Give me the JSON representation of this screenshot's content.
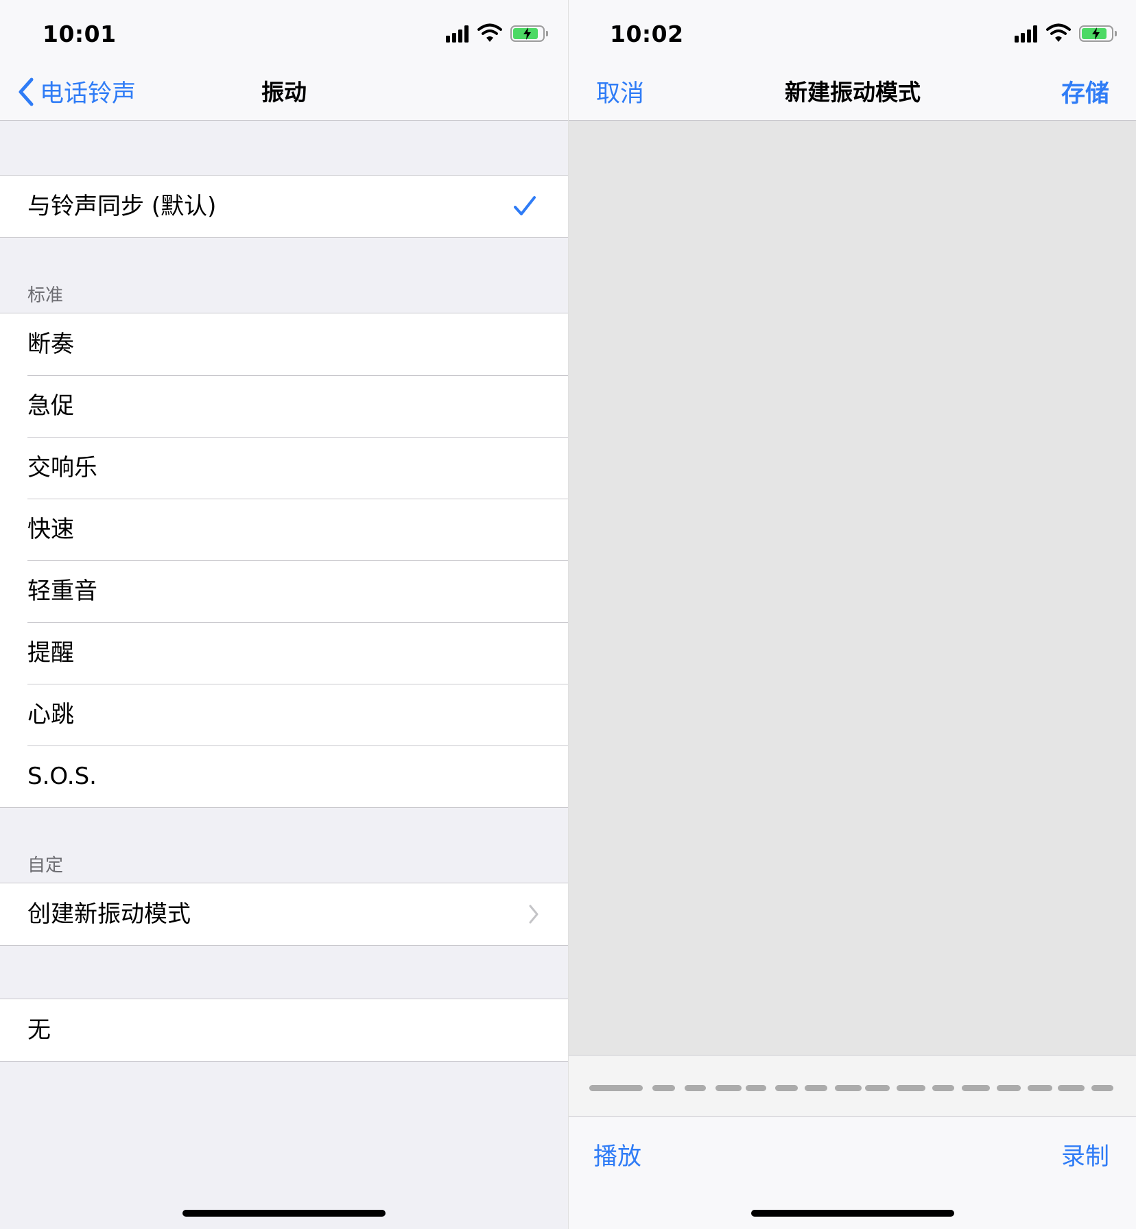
{
  "left": {
    "status": {
      "time": "10:01"
    },
    "nav": {
      "back_label": "电话铃声",
      "title": "振动"
    },
    "sync_row": {
      "label": "与铃声同步 (默认)",
      "selected": true
    },
    "standard": {
      "header": "标准",
      "items": [
        {
          "label": "断奏"
        },
        {
          "label": "急促"
        },
        {
          "label": "交响乐"
        },
        {
          "label": "快速"
        },
        {
          "label": "轻重音"
        },
        {
          "label": "提醒"
        },
        {
          "label": "心跳"
        },
        {
          "label": "S.O.S."
        }
      ]
    },
    "custom": {
      "header": "自定",
      "create_label": "创建新振动模式"
    },
    "none_label": "无"
  },
  "right": {
    "status": {
      "time": "10:02"
    },
    "nav": {
      "cancel_label": "取消",
      "title": "新建振动模式",
      "save_label": "存储"
    },
    "toolbar": {
      "play_label": "播放",
      "record_label": "录制"
    }
  },
  "colors": {
    "accent": "#2f7cf6",
    "background_grouped": "#f0f0f5",
    "canvas_gray": "#e5e5e5",
    "battery_green": "#4cd964"
  },
  "icons": {
    "signal": "signal-bars-icon",
    "wifi": "wifi-icon",
    "battery": "battery-charging-icon",
    "back": "chevron-left-icon",
    "check": "checkmark-icon",
    "disclosure": "chevron-right-icon"
  }
}
